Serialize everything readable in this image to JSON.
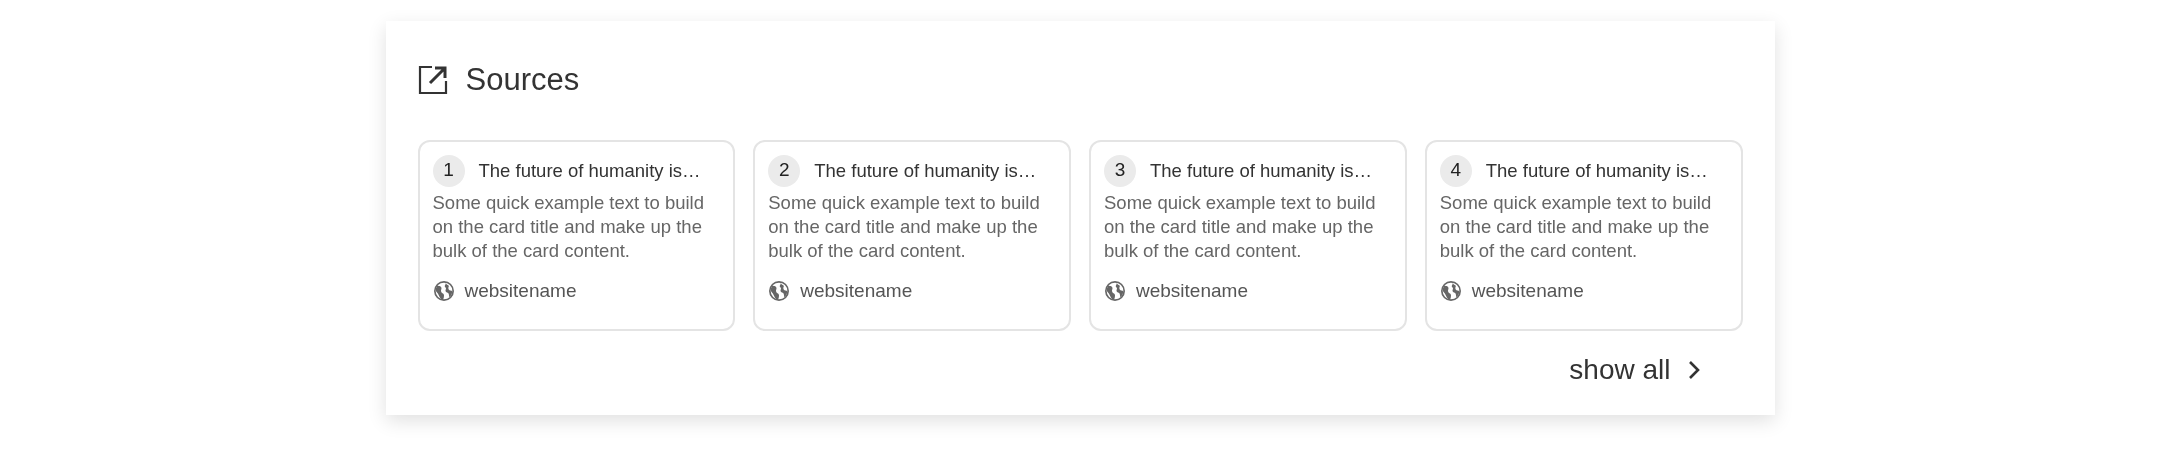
{
  "panel": {
    "title": "Sources"
  },
  "sources": [
    {
      "number": "1",
      "title": "The future of humanity is…",
      "text": "Some quick example text to build on the card title and make up the bulk of the card content.",
      "site": "websitename"
    },
    {
      "number": "2",
      "title": "The future of humanity is…",
      "text": "Some quick example text to build on the card title and make up the bulk of the card content.",
      "site": "websitename"
    },
    {
      "number": "3",
      "title": "The future of humanity is…",
      "text": "Some quick example text to build on the card title and make up the bulk of the card content.",
      "site": "websitename"
    },
    {
      "number": "4",
      "title": "The future of humanity is…",
      "text": "Some quick example text to build on the card title and make up the bulk of the card content.",
      "site": "websitename"
    }
  ],
  "show_all": {
    "label": "show all"
  }
}
